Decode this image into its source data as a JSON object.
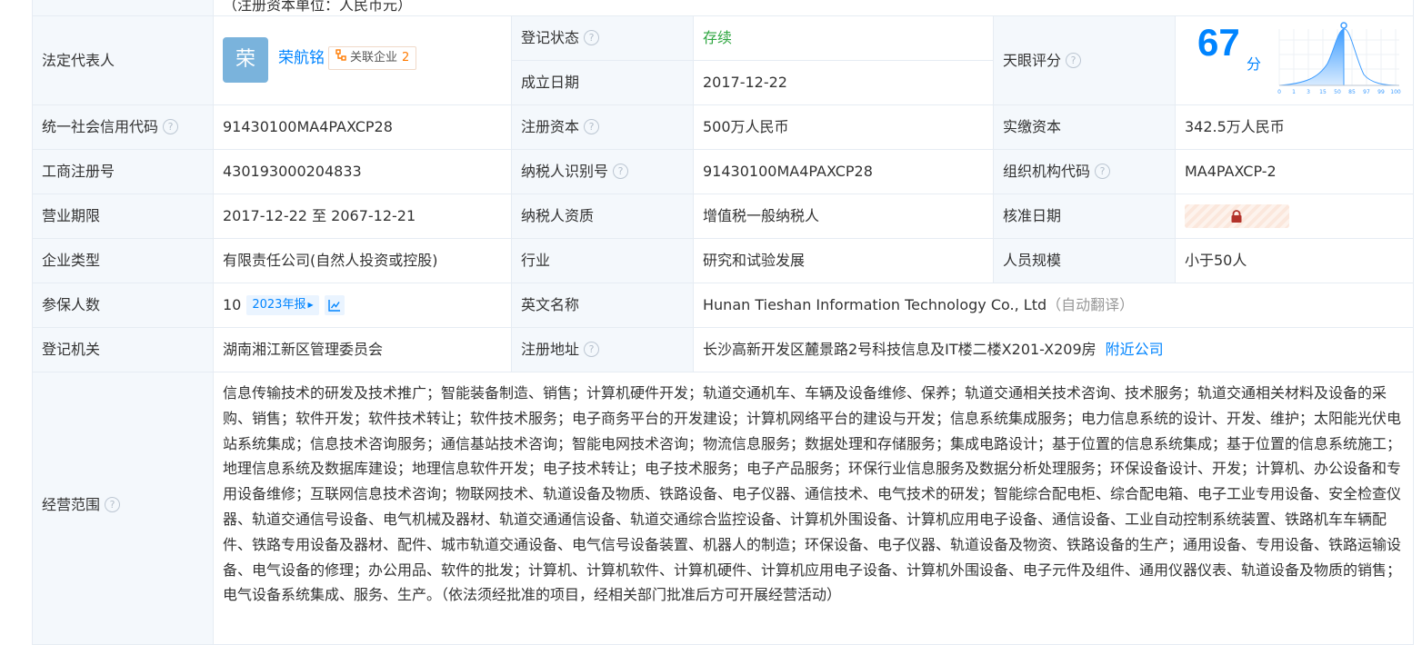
{
  "rows": {
    "top_value": "（注册资本单位：人民币元）",
    "legal_rep": {
      "label": "法定代表人",
      "avatar_char": "荣",
      "name": "荣航铭",
      "related_label": "关联企业",
      "related_count": "2"
    },
    "reg_status": {
      "label": "登记状态",
      "value": "存续",
      "value_color": "#2fa641"
    },
    "est_date": {
      "label": "成立日期",
      "value": "2017-12-22"
    },
    "tianyan": {
      "label": "天眼评分",
      "score": "67",
      "unit": "分",
      "ticks": [
        "0",
        "1",
        "3",
        "15",
        "50",
        "85",
        "97",
        "99",
        "100"
      ]
    },
    "credit_code": {
      "label": "统一社会信用代码",
      "value": "91430100MA4PAXCP28"
    },
    "reg_capital": {
      "label": "注册资本",
      "value": "500万人民币"
    },
    "paid_capital": {
      "label": "实缴资本",
      "value": "342.5万人民币"
    },
    "biz_reg_no": {
      "label": "工商注册号",
      "value": "430193000204833"
    },
    "taxpayer_id": {
      "label": "纳税人识别号",
      "value": "91430100MA4PAXCP28"
    },
    "org_code": {
      "label": "组织机构代码",
      "value": "MA4PAXCP-2"
    },
    "biz_term": {
      "label": "营业期限",
      "value": "2017-12-22 至 2067-12-21"
    },
    "taxpayer_qual": {
      "label": "纳税人资质",
      "value": "增值税一般纳税人"
    },
    "approve_date": {
      "label": "核准日期"
    },
    "company_type": {
      "label": "企业类型",
      "value": "有限责任公司(自然人投资或控股)"
    },
    "industry": {
      "label": "行业",
      "value": "研究和试验发展"
    },
    "staff_size": {
      "label": "人员规模",
      "value": "小于50人"
    },
    "insured": {
      "label": "参保人数",
      "value": "10",
      "report_label": "2023年报"
    },
    "english_name": {
      "label": "英文名称",
      "value": "Hunan Tieshan Information Technology Co., Ltd",
      "note": "（自动翻译）"
    },
    "reg_authority": {
      "label": "登记机关",
      "value": "湖南湘江新区管理委员会"
    },
    "reg_address": {
      "label": "注册地址",
      "value": "长沙高新开发区麓景路2号科技信息及IT楼二楼X201-X209房",
      "link": "附近公司"
    },
    "biz_scope": {
      "label": "经营范围",
      "value": "信息传输技术的研发及技术推广；智能装备制造、销售；计算机硬件开发；轨道交通机车、车辆及设备维修、保养；轨道交通相关技术咨询、技术服务；轨道交通相关材料及设备的采购、销售；软件开发；软件技术转让；软件技术服务；电子商务平台的开发建设；计算机网络平台的建设与开发；信息系统集成服务；电力信息系统的设计、开发、维护；太阳能光伏电站系统集成；信息技术咨询服务；通信基站技术咨询；智能电网技术咨询；物流信息服务；数据处理和存储服务；集成电路设计；基于位置的信息系统集成；基于位置的信息系统施工；地理信息系统及数据库建设；地理信息软件开发；电子技术转让；电子技术服务；电子产品服务；环保行业信息服务及数据分析处理服务；环保设备设计、开发；计算机、办公设备和专用设备维修；互联网信息技术咨询；物联网技术、轨道设备及物质、铁路设备、电子仪器、通信技术、电气技术的研发；智能综合配电柜、综合配电箱、电子工业专用设备、安全检查仪器、轨道交通信号设备、电气机械及器材、轨道交通通信设备、轨道交通综合监控设备、计算机外围设备、计算机应用电子设备、通信设备、工业自动控制系统装置、铁路机车车辆配件、铁路专用设备及器材、配件、城市轨道交通设备、电气信号设备装置、机器人的制造；环保设备、电子仪器、轨道设备及物资、铁路设备的生产；通用设备、专用设备、铁路运输设备、电气设备的修理；办公用品、软件的批发；计算机、计算机软件、计算机硬件、计算机应用电子设备、计算机外围设备、电子元件及组件、通用仪器仪表、轨道设备及物质的销售；电气设备系统集成、服务、生产。（依法须经批准的项目，经相关部门批准后方可开展经营活动）"
    }
  },
  "icons": {
    "help": "help-circle-icon",
    "related": "org-chart-icon",
    "lock": "lock-icon",
    "trend": "trend-chart-icon"
  },
  "colors": {
    "label_bg": "#f4f8fc",
    "border": "#e6ecf3",
    "link": "#0084ff",
    "status_green": "#2fa641",
    "avatar_bg": "#7ab3dc",
    "accent_orange": "#ff7a00"
  }
}
